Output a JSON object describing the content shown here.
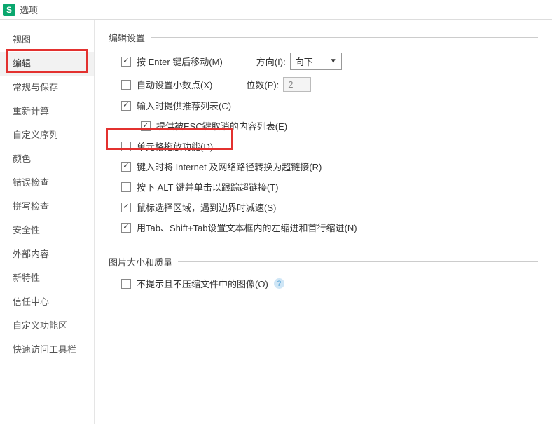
{
  "title": "选项",
  "app_icon_letter": "S",
  "sidebar": {
    "items": [
      {
        "label": "视图"
      },
      {
        "label": "编辑"
      },
      {
        "label": "常规与保存"
      },
      {
        "label": "重新计算"
      },
      {
        "label": "自定义序列"
      },
      {
        "label": "颜色"
      },
      {
        "label": "错误检查"
      },
      {
        "label": "拼写检查"
      },
      {
        "label": "安全性"
      },
      {
        "label": "外部内容"
      },
      {
        "label": "新特性"
      },
      {
        "label": "信任中心"
      },
      {
        "label": "自定义功能区"
      },
      {
        "label": "快速访问工具栏"
      }
    ],
    "active_index": 1
  },
  "sections": {
    "edit": {
      "legend": "编辑设置",
      "enter_move": {
        "label": "按 Enter 键后移动(M)",
        "checked": true
      },
      "direction_label": "方向(I):",
      "direction_value": "向下",
      "auto_decimal": {
        "label": "自动设置小数点(X)",
        "checked": false
      },
      "places_label": "位数(P):",
      "places_value": "2",
      "suggest_list": {
        "label": "输入时提供推荐列表(C)",
        "checked": true
      },
      "esc_list": {
        "label": "提供被ESC键取消的内容列表(E)",
        "checked": true
      },
      "drag_drop": {
        "label": "单元格拖放功能(D)",
        "checked": false
      },
      "url_link": {
        "label": "键入时将 Internet 及网络路径转换为超链接(R)",
        "checked": true
      },
      "alt_click": {
        "label": "按下 ALT 键并单击以跟踪超链接(T)",
        "checked": false
      },
      "mouse_select": {
        "label": "鼠标选择区域，遇到边界时减速(S)",
        "checked": true
      },
      "tab_indent": {
        "label": "用Tab、Shift+Tab设置文本框内的左缩进和首行缩进(N)",
        "checked": true
      }
    },
    "img": {
      "legend": "图片大小和质量",
      "no_compress": {
        "label": "不提示且不压缩文件中的图像(O)",
        "checked": false
      }
    }
  }
}
